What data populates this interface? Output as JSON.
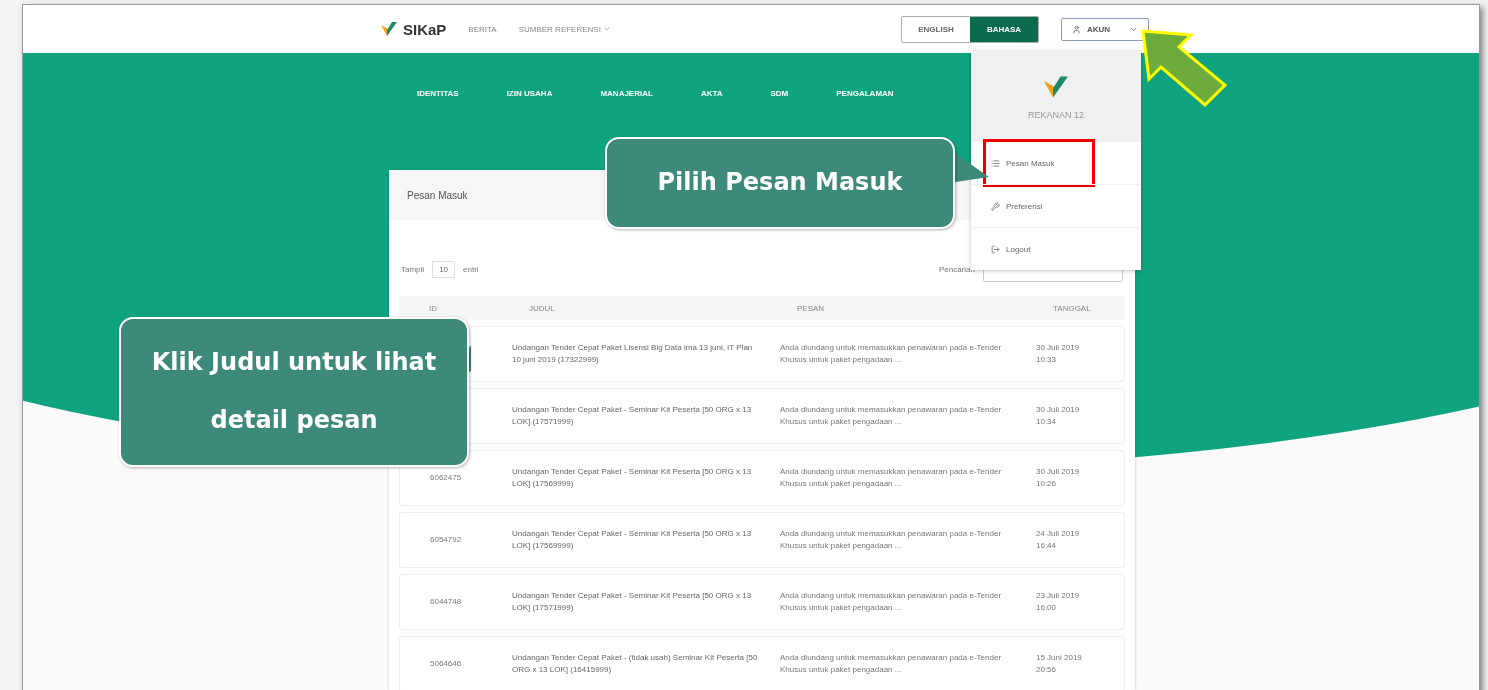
{
  "header": {
    "logo": "SIKaP",
    "nav": [
      {
        "label": "BERITA",
        "dropdown": false
      },
      {
        "label": "SUMBER REFERENSI",
        "dropdown": true
      }
    ],
    "languages": [
      {
        "label": "ENGLISH",
        "selected": false
      },
      {
        "label": "BAHASA",
        "selected": true
      }
    ],
    "account": "AKUN"
  },
  "menu": [
    "IDENTITAS",
    "IZIN USAHA",
    "MANAJERIAL",
    "AKTA",
    "SDM",
    "PENGALAMAN"
  ],
  "account_menu": {
    "name": "REKANAN 12",
    "items": [
      {
        "label": "Pesan Masuk",
        "kind": "inbox",
        "highlighted": true
      },
      {
        "label": "Preferensi",
        "kind": "settings",
        "highlighted": false
      },
      {
        "label": "Logout",
        "kind": "logout",
        "highlighted": false
      }
    ]
  },
  "card": {
    "title": "Pesan Masuk",
    "length": {
      "before": "Tampil",
      "value": "10",
      "after": "entri"
    },
    "search": {
      "label": "Pencarian"
    },
    "columns": [
      "ID",
      "JUDUL",
      "PESAN",
      "TANGGAL"
    ],
    "rows": [
      {
        "title": "Undangan Tender Cepat Paket Lisensi Big Data ima 13 juni, IT Plan 10 juni 2019 (17322999)",
        "message": "Anda diundang untuk memasukkan penawaran pada e-Tender Khusus untuk paket pengadaan ...",
        "date": "30 Juli 2019",
        "time": "10:33"
      },
      {
        "title": "Undangan Tender Cepat Paket - Seminar Kit Peserta [50 ORG x 13 LOK] (17571999)",
        "message": "Anda diundang untuk memasukkan penawaran pada e-Tender Khusus untuk paket pengadaan ...",
        "date": "30 Juli 2019",
        "time": "10:34"
      },
      {
        "id": "6062475",
        "title": "Undangan Tender Cepat Paket - Seminar Kit Peserta [50 ORG x 13 LOK] (17569999)",
        "message": "Anda diundang untuk memasukkan penawaran pada e-Tender Khusus untuk paket pengadaan ...",
        "date": "30 Juli 2019",
        "time": "10:26"
      },
      {
        "id": "6054792",
        "title": "Undangan Tender Cepat Paket - Seminar Kit Peserta [50 ORG x 13 LOK] (17569999)",
        "message": "Anda diundang untuk memasukkan penawaran pada e-Tender Khusus untuk paket pengadaan ...",
        "date": "24 Juli 2019",
        "time": "16:44"
      },
      {
        "id": "6044748",
        "title": "Undangan Tender Cepat Paket - Seminar Kit Peserta [50 ORG x 13 LOK] (17571999)",
        "message": "Anda diundang untuk memasukkan penawaran pada e-Tender Khusus untuk paket pengadaan ...",
        "date": "23 Juli 2019",
        "time": "16:00"
      },
      {
        "id": "5064646",
        "title": "Undangan Tender Cepat Paket - (tidak usah) Seminar Kit Peserta [50 ORG x 13 LOK] (16415999)",
        "message": "Anda diundang untuk memasukkan penawaran pada e-Tender Khusus untuk paket pengadaan ...",
        "date": "15 Juni 2019",
        "time": "20:56"
      }
    ]
  },
  "callouts": [
    "Pilih Pesan Masuk",
    "Klik Judul untuk lihat detail pesan"
  ]
}
